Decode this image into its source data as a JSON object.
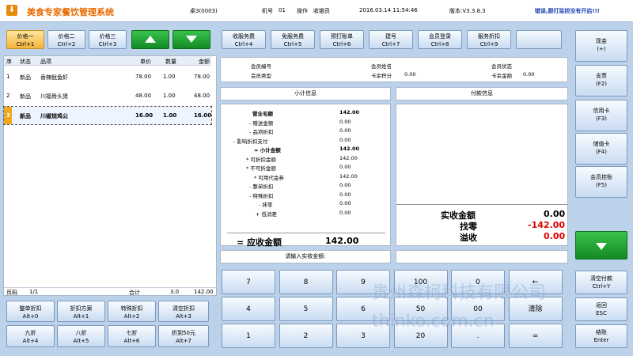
{
  "app": {
    "title": "美食专家餐饮管理系统",
    "table": "桌3(0003)",
    "machine_label": "机号",
    "machine_no": "01",
    "operator_label": "操作",
    "operator": "收银员",
    "datetime": "2016.03.14 11:54:46",
    "version": "版本:V3.3.8.3",
    "warning": "错误,厨打监控没有开启!!!"
  },
  "price_buttons": [
    {
      "label": "价格一",
      "key": "Ctrl+1"
    },
    {
      "label": "价格二",
      "key": "Ctrl+2"
    },
    {
      "label": "价格三",
      "key": "Ctrl+3"
    }
  ],
  "order": {
    "headers": {
      "idx": "序",
      "status": "状态",
      "item": "品项",
      "price": "单价",
      "qty": "数量",
      "amount": "金额"
    },
    "rows": [
      {
        "idx": "1",
        "status": "新品",
        "item": "香辣鱿鱼虾",
        "price": "78.00",
        "qty": "1.00",
        "amount": "78.00"
      },
      {
        "idx": "2",
        "status": "新品",
        "item": "川福骨头煲",
        "price": "48.00",
        "qty": "1.00",
        "amount": "48.00"
      },
      {
        "idx": "3",
        "status": "新品",
        "item": "川椒烧鸡公",
        "price": "16.00",
        "qty": "1.00",
        "amount": "16.00"
      }
    ],
    "footer": {
      "page_label": "页码",
      "page": "1/1",
      "total_label": "合计",
      "qty": "3.0",
      "amount": "142.00"
    }
  },
  "discount_buttons": [
    {
      "label": "整单折扣",
      "key": "Alt+0"
    },
    {
      "label": "折扣方案",
      "key": "Alt+1"
    },
    {
      "label": "特殊折扣",
      "key": "Alt+2"
    },
    {
      "label": "清空折扣",
      "key": "Alt+3"
    },
    {
      "label": "九折",
      "key": "Alt+4"
    },
    {
      "label": "八折",
      "key": "Alt+5"
    },
    {
      "label": "七折",
      "key": "Alt+6"
    },
    {
      "label": "折到50元",
      "key": "Alt+7"
    }
  ],
  "func_buttons": [
    {
      "label": "收服务费",
      "key": "Ctrl+4"
    },
    {
      "label": "免服务费",
      "key": "Ctrl+5"
    },
    {
      "label": "预打账单",
      "key": "Ctrl+6"
    },
    {
      "label": "建号",
      "key": "Ctrl+7"
    },
    {
      "label": "会员登录",
      "key": "Ctrl+8"
    },
    {
      "label": "服务折扣",
      "key": "Ctrl+9"
    },
    {
      "label": "",
      "key": ""
    }
  ],
  "member": {
    "no_label": "会员编号",
    "type_label": "会员类型",
    "name_label": "会员姓名",
    "points_label": "卡余积分",
    "points": "0.00",
    "status_label": "会员状态",
    "balance_label": "卡余金额",
    "balance": "0.00"
  },
  "subtotal": {
    "title": "小计信息",
    "lines": [
      {
        "label": "营业毛额",
        "value": "142.00"
      },
      {
        "label": "- 赠送金额",
        "value": "0.00"
      },
      {
        "label": "- 品项折扣",
        "value": "0.00"
      },
      {
        "label": "- 影响折扣支付",
        "value": "0.00"
      },
      {
        "label": "= 小计金额",
        "value": "142.00"
      },
      {
        "label": "* 可折扣金额",
        "value": "142.00"
      },
      {
        "label": "* 不可折金额",
        "value": "0.00"
      },
      {
        "label": "* 可用代金券",
        "value": "142.00"
      },
      {
        "label": "- 整单折扣",
        "value": "0.00"
      },
      {
        "label": "- 特殊折扣",
        "value": "0.00"
      },
      {
        "label": "- 抹零",
        "value": "0.00"
      },
      {
        "label": "+ 低消差",
        "value": "0.00"
      }
    ],
    "due_label": "= 应收金额",
    "due_value": "142.00"
  },
  "payment": {
    "title": "付款信息",
    "received_label": "实收金额",
    "received": "0.00",
    "change_label": "找零",
    "change": "-142.00",
    "over_label": "溢收",
    "over": "0.00"
  },
  "input": {
    "label": "请输入实收金额:"
  },
  "numpad": [
    "7",
    "8",
    "9",
    "100",
    "0",
    "←",
    "4",
    "5",
    "6",
    "50",
    "00",
    "清除",
    "1",
    "2",
    "3",
    "20",
    ".",
    "="
  ],
  "pay_buttons": [
    {
      "label": "现金",
      "key": "(+)"
    },
    {
      "label": "支票",
      "key": "(F2)"
    },
    {
      "label": "信用卡",
      "key": "(F3)"
    },
    {
      "label": "储值卡",
      "key": "(F4)"
    },
    {
      "label": "会员挂账",
      "key": "(F5)"
    }
  ],
  "bottom_buttons": [
    {
      "label": "清空付款",
      "key": "Ctrl+Y"
    },
    {
      "label": "返回",
      "key": "ESC"
    },
    {
      "label": "结账",
      "key": "Enter"
    }
  ],
  "watermark": {
    "line1": "贵州森柯科技有限公司",
    "line2": "thinko.com.cn"
  },
  "colors": {
    "accent": "#e86b00",
    "change": "#e00000",
    "warning": "#1b3fb0",
    "green": "#1aa02e"
  }
}
